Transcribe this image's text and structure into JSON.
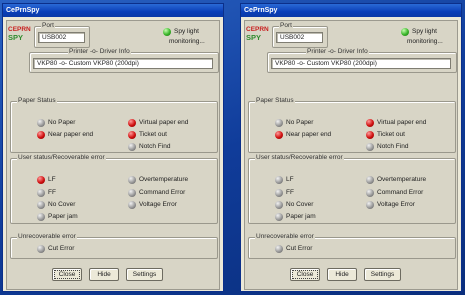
{
  "app": {
    "title": "CePrnSpy"
  },
  "logo": {
    "line1": "CEPRN",
    "line2": "SPY"
  },
  "port": {
    "legend": "Port",
    "value": "USB002"
  },
  "spy": {
    "line1": "Spy light",
    "line2": "monitoring..."
  },
  "printer": {
    "legend": "Printer -o- Driver Info",
    "value": "VKP80 -o- Custom VKP80 (200dpi)"
  },
  "paper_status": {
    "legend": "Paper Status",
    "items": [
      "No Paper",
      "Near paper end",
      "Virtual paper end",
      "Ticket out",
      "Notch Find"
    ]
  },
  "user_status": {
    "legend": "User status/Recoverable error",
    "items": [
      "LF",
      "FF",
      "No Cover",
      "Paper jam",
      "Overtemperature",
      "Command Error",
      "Voltage Error"
    ]
  },
  "unrecoverable": {
    "legend": "Unrecoverable error",
    "items": [
      "Cut Error"
    ]
  },
  "buttons": {
    "close": "Close",
    "hide": "Hide",
    "settings": "Settings"
  },
  "windows": [
    {
      "leds": {
        "paper": [
          "grey",
          "red",
          "red",
          "red",
          "grey"
        ],
        "user": [
          "red",
          "grey",
          "grey",
          "grey",
          "grey",
          "grey",
          "grey"
        ],
        "unrec": [
          "grey"
        ]
      }
    },
    {
      "leds": {
        "paper": [
          "grey",
          "red",
          "red",
          "red",
          "grey"
        ],
        "user": [
          "grey",
          "grey",
          "grey",
          "grey",
          "grey",
          "grey",
          "grey"
        ],
        "unrec": [
          "grey"
        ]
      }
    }
  ],
  "colors": {
    "red": "#d01010",
    "grey": "#9a9a9a",
    "green": "#39b52a",
    "title_blue": "#0a3fb8"
  }
}
